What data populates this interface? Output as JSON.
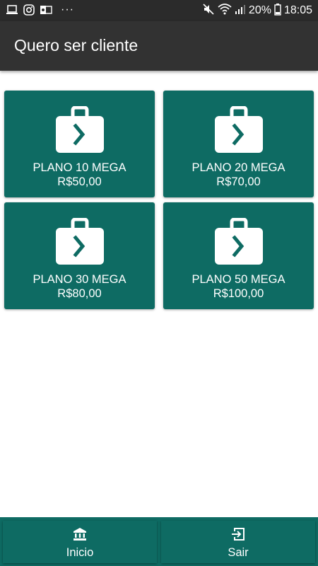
{
  "status_bar": {
    "battery_percent": "20%",
    "time": "18:05",
    "left_icons": [
      "laptop-icon",
      "instagram-icon",
      "outlook-icon",
      "more-dots-icon"
    ],
    "right_icons": [
      "mute-icon",
      "wifi-icon",
      "signal-icon",
      "battery-icon"
    ]
  },
  "app_bar": {
    "title": "Quero ser cliente"
  },
  "plans": [
    {
      "name": "PLANO 10 MEGA",
      "price": "R$50,00",
      "icon": "briefcase-arrow-icon"
    },
    {
      "name": "PLANO 20 MEGA",
      "price": "R$70,00",
      "icon": "briefcase-arrow-icon"
    },
    {
      "name": "PLANO 30 MEGA",
      "price": "R$80,00",
      "icon": "briefcase-arrow-icon"
    },
    {
      "name": "PLANO 50 MEGA",
      "price": "R$100,00",
      "icon": "briefcase-arrow-icon"
    }
  ],
  "bottom_nav": {
    "items": [
      {
        "label": "Inicio",
        "icon": "bank-icon"
      },
      {
        "label": "Sair",
        "icon": "exit-icon"
      }
    ]
  },
  "colors": {
    "primary": "#0e6b63",
    "app_bar": "#323232",
    "status_bar": "#2b2b2b",
    "text_on_primary": "#ffffff"
  }
}
